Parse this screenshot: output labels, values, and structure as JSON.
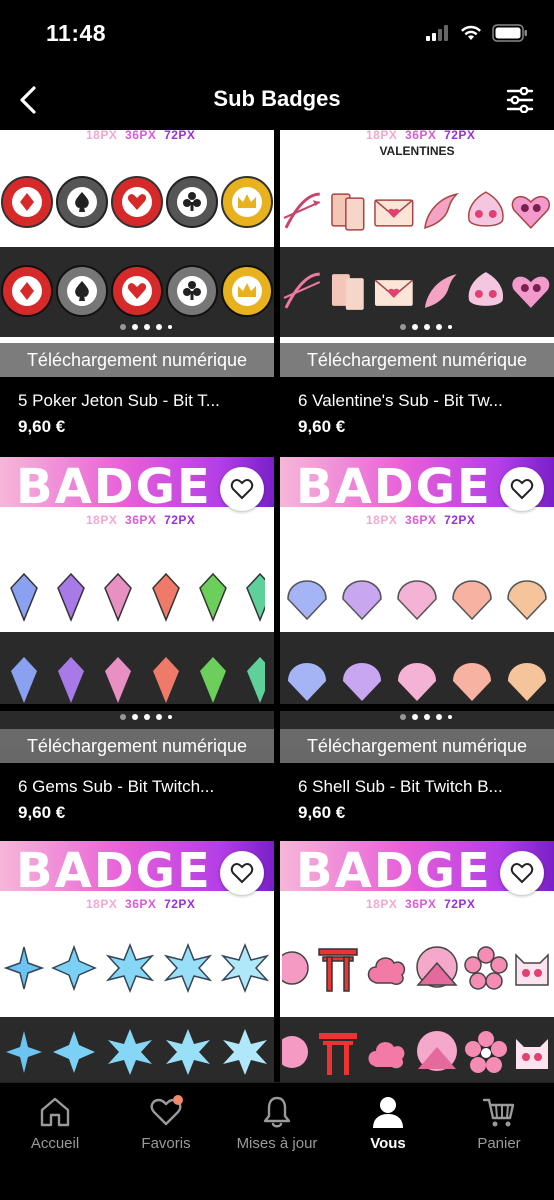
{
  "status": {
    "time": "11:48"
  },
  "nav": {
    "title": "Sub Badges"
  },
  "products": [
    {
      "image_text": {
        "sizes": [
          "18PX",
          "36PX",
          "72PX"
        ],
        "extra": ""
      },
      "download": "Téléchargement numérique",
      "title": "5 Poker Jeton Sub - Bit T...",
      "price": "9,60 €"
    },
    {
      "image_text": {
        "sizes": [
          "18PX",
          "36PX",
          "72PX"
        ],
        "extra": "VALENTINES"
      },
      "download": "Téléchargement numérique",
      "title": "6 Valentine's Sub - Bit Tw...",
      "price": "9,60 €"
    },
    {
      "image_text": {
        "banner": "BADGE",
        "sizes": [
          "18PX",
          "36PX",
          "72PX"
        ]
      },
      "download": "Téléchargement numérique",
      "title": "6 Gems Sub - Bit Twitch...",
      "price": "9,60 €"
    },
    {
      "image_text": {
        "banner": "BADGE",
        "sizes": [
          "18PX",
          "36PX",
          "72PX"
        ]
      },
      "download": "Téléchargement numérique",
      "title": "6 Shell Sub - Bit Twitch B...",
      "price": "9,60 €"
    },
    {
      "image_text": {
        "banner": "BADGE",
        "sizes": [
          "18PX",
          "36PX",
          "72PX"
        ]
      }
    },
    {
      "image_text": {
        "banner": "BADGE",
        "sizes": [
          "18PX",
          "36PX",
          "72PX"
        ]
      }
    }
  ],
  "tabs": [
    {
      "label": "Accueil",
      "icon": "home-icon"
    },
    {
      "label": "Favoris",
      "icon": "heart-icon"
    },
    {
      "label": "Mises à jour",
      "icon": "bell-icon"
    },
    {
      "label": "Vous",
      "icon": "person-icon"
    },
    {
      "label": "Panier",
      "icon": "cart-icon"
    }
  ],
  "colors": {
    "accent_badge": "#b43fe6",
    "notification": "#f08a6a"
  }
}
